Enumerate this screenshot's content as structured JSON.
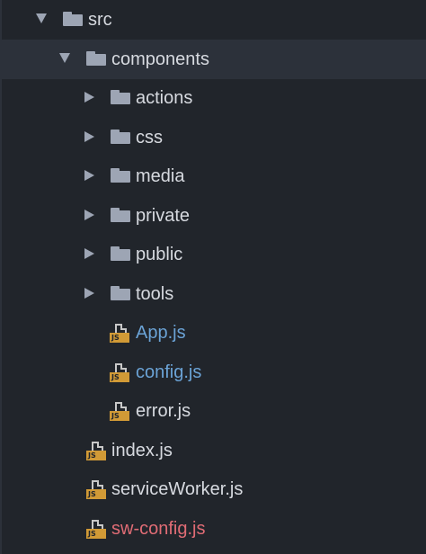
{
  "tree": {
    "items": [
      {
        "type": "folder",
        "label": "src",
        "expanded": true,
        "icon": "folder-icon"
      },
      {
        "type": "folder",
        "label": "components",
        "expanded": true,
        "icon": "folder-icon"
      },
      {
        "type": "folder",
        "label": "actions",
        "expanded": false,
        "icon": "folder-icon"
      },
      {
        "type": "folder",
        "label": "css",
        "expanded": false,
        "icon": "folder-icon"
      },
      {
        "type": "folder",
        "label": "media",
        "expanded": false,
        "icon": "folder-icon"
      },
      {
        "type": "folder",
        "label": "private",
        "expanded": false,
        "icon": "folder-icon"
      },
      {
        "type": "folder",
        "label": "public",
        "expanded": false,
        "icon": "folder-icon"
      },
      {
        "type": "folder",
        "label": "tools",
        "expanded": false,
        "icon": "folder-icon"
      },
      {
        "type": "file",
        "label": "App.js",
        "status": "modified",
        "icon": "js-file-icon",
        "badge": "JS"
      },
      {
        "type": "file",
        "label": "config.js",
        "status": "modified",
        "icon": "js-file-icon",
        "badge": "JS"
      },
      {
        "type": "file",
        "label": "error.js",
        "status": "normal",
        "icon": "js-file-icon",
        "badge": "JS"
      },
      {
        "type": "file",
        "label": "index.js",
        "status": "normal",
        "icon": "js-file-icon",
        "badge": "JS"
      },
      {
        "type": "file",
        "label": "serviceWorker.js",
        "status": "normal",
        "icon": "js-file-icon",
        "badge": "JS"
      },
      {
        "type": "file",
        "label": "sw-config.js",
        "status": "ignored",
        "icon": "js-file-icon",
        "badge": "JS"
      }
    ]
  },
  "colors": {
    "background": "#21252b",
    "selected_row": "#2c313a",
    "text": "#d7dae0",
    "modified": "#6ba3d6",
    "ignored": "#e06c75",
    "icon": "#9da5b4",
    "js_badge": "#d19a36"
  }
}
